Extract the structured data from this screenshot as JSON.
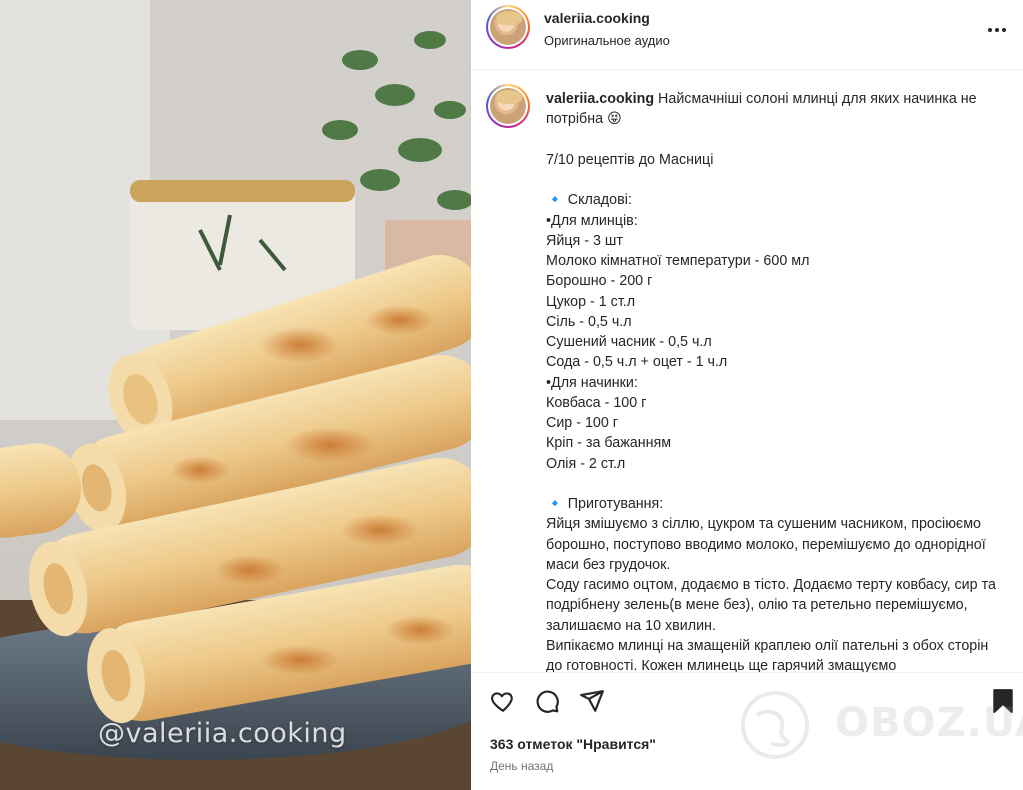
{
  "media": {
    "watermark": "@valeriia.cooking"
  },
  "header": {
    "username": "valeriia.cooking",
    "subtitle": "Оригинальное аудио",
    "more_icon": "more-horizontal-icon"
  },
  "caption": {
    "username": "valeriia.cooking",
    "text": " Найсмачніші солоні млинці для яких начинка не потрібна 😝\n\n7/10 рецептів до Масниці\n\n🔹 Складові:\n•Для млинців:\nЯйця - 3 шт\nМолоко кімнатної температури - 600 мл\nБорошно - 200 г\nЦукор - 1 ст.л\nСіль - 0,5 ч.л\nСушений часник - 0,5 ч.л\nСода - 0,5 ч.л + оцет - 1 ч.л\n•Для начинки:\nКовбаса - 100 г\nСир - 100 г\nКріп - за бажанням\nОлія - 2 ст.л\n\n🔹 Приготування:\nЯйця змішуємо з сіллю, цукром та сушеним часником, просіюємо борошно, поступово вводимо молоко, перемішуємо до однорідної маси без грудочок.\nСоду гасимо оцтом, додаємо в тісто. Додаємо терту ковбасу, сир та подрібнену зелень(в мене без), олію та ретельно перемішуємо, залишаємо на 10 хвилин.\nВипікаємо млинці на змащеній краплею олії пательні з обох сторін до готовності. Кожен млинець ще гарячий змащуємо"
  },
  "actions": {
    "like_icon": "heart-icon",
    "comment_icon": "comment-icon",
    "share_icon": "send-icon",
    "save_icon": "bookmark-icon",
    "likes_text": "363 отметок \"Нравится\"",
    "time_text": "День назад"
  },
  "overlay": {
    "logo_text": "OBOZ.UA"
  },
  "colors": {
    "text": "#262626",
    "secondary": "#737373",
    "divider": "#efefef"
  }
}
